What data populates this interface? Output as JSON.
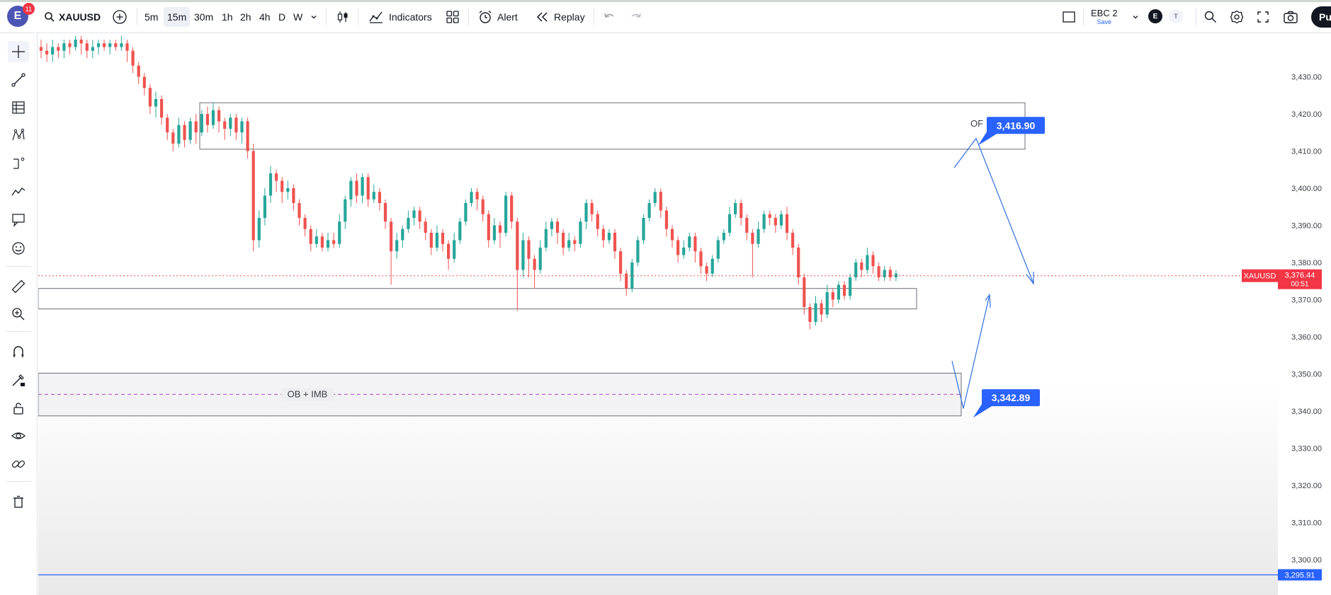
{
  "header": {
    "logo_letter": "E",
    "notification_count": "11",
    "symbol": "XAUUSD",
    "intervals": [
      "5m",
      "15m",
      "30m",
      "1h",
      "2h",
      "4h",
      "D",
      "W"
    ],
    "active_interval": "15m",
    "indicators_label": "Indicators",
    "alert_label": "Alert",
    "replay_label": "Replay",
    "layout_name": "EBC 2",
    "save_label": "Save",
    "account_chip": "E",
    "account_chip_secondary": "T",
    "publish_label": "Pub"
  },
  "chart_data": {
    "type": "candlestick",
    "symbol": "XAUUSD",
    "timeframe": "15m",
    "y_ticks": [
      "3,430.00",
      "3,420.00",
      "3,410.00",
      "3,400.00",
      "3,390.00",
      "3,380.00",
      "3,370.00",
      "3,360.00",
      "3,350.00",
      "3,340.00",
      "3,330.00",
      "3,320.00",
      "3,310.00",
      "3,300.00"
    ],
    "ylim": [
      3292,
      3440
    ],
    "current_price": "3,376.44",
    "current_price_value": 3376.44,
    "countdown": "00:51",
    "price_tag_label": "XAUUSD",
    "bottom_level": "3,295.91",
    "bottom_level_value": 3295.91,
    "zones": [
      {
        "name": "upper-zone",
        "top": 3423,
        "bottom": 3410.5,
        "label": "OF",
        "target": "3,416.90",
        "target_value": 3416.9
      },
      {
        "name": "middle-zone",
        "top": 3373,
        "bottom": 3367.5
      },
      {
        "name": "ob-imb-zone",
        "top": 3350.2,
        "bottom": 3338.7,
        "label": "OB + IMB",
        "target": "3,342.89",
        "target_value": 3342.89,
        "midline": 3344.5
      }
    ],
    "candles": [
      [
        3438,
        3437,
        3440,
        3435
      ],
      [
        3437,
        3436,
        3439,
        3434
      ],
      [
        3436,
        3438,
        3440,
        3434
      ],
      [
        3438,
        3437,
        3439,
        3435
      ],
      [
        3437,
        3439,
        3440,
        3435
      ],
      [
        3439,
        3438,
        3440,
        3436
      ],
      [
        3438,
        3440,
        3441,
        3437
      ],
      [
        3440,
        3439,
        3441,
        3436
      ],
      [
        3439,
        3437,
        3440,
        3435
      ],
      [
        3437,
        3438,
        3440,
        3435
      ],
      [
        3438,
        3439,
        3440,
        3436
      ],
      [
        3439,
        3438,
        3440,
        3437
      ],
      [
        3438,
        3439,
        3440,
        3436
      ],
      [
        3439,
        3438,
        3440,
        3437
      ],
      [
        3438,
        3439,
        3441,
        3437
      ],
      [
        3439,
        3437,
        3440,
        3434
      ],
      [
        3437,
        3433,
        3438,
        3431
      ],
      [
        3433,
        3430,
        3434,
        3428
      ],
      [
        3430,
        3427,
        3431,
        3425
      ],
      [
        3427,
        3422,
        3428,
        3420
      ],
      [
        3422,
        3424,
        3426,
        3419
      ],
      [
        3424,
        3419,
        3425,
        3417
      ],
      [
        3419,
        3415,
        3420,
        3413
      ],
      [
        3415,
        3412,
        3416,
        3410
      ],
      [
        3412,
        3417,
        3419,
        3411
      ],
      [
        3417,
        3413,
        3418,
        3411
      ],
      [
        3413,
        3418,
        3419,
        3412
      ],
      [
        3418,
        3415,
        3420,
        3412
      ],
      [
        3415,
        3420,
        3421,
        3414
      ],
      [
        3420,
        3417,
        3422,
        3415
      ],
      [
        3417,
        3421,
        3423,
        3416
      ],
      [
        3421,
        3418,
        3422,
        3415
      ],
      [
        3418,
        3416,
        3419,
        3413
      ],
      [
        3416,
        3419,
        3420,
        3414
      ],
      [
        3419,
        3415,
        3420,
        3413
      ],
      [
        3415,
        3418,
        3419,
        3412
      ],
      [
        3418,
        3410,
        3419,
        3408
      ],
      [
        3410,
        3386,
        3412,
        3383
      ],
      [
        3386,
        3392,
        3394,
        3384
      ],
      [
        3392,
        3398,
        3400,
        3390
      ],
      [
        3398,
        3404,
        3406,
        3396
      ],
      [
        3404,
        3402,
        3405,
        3399
      ],
      [
        3402,
        3399,
        3403,
        3396
      ],
      [
        3399,
        3400,
        3402,
        3397
      ],
      [
        3400,
        3396,
        3401,
        3394
      ],
      [
        3396,
        3392,
        3397,
        3390
      ],
      [
        3392,
        3389,
        3393,
        3387
      ],
      [
        3389,
        3385,
        3390,
        3383
      ],
      [
        3385,
        3387,
        3389,
        3384
      ],
      [
        3387,
        3384,
        3388,
        3383
      ],
      [
        3384,
        3386,
        3388,
        3383
      ],
      [
        3386,
        3385,
        3388,
        3384
      ],
      [
        3385,
        3391,
        3393,
        3384
      ],
      [
        3391,
        3397,
        3398,
        3389
      ],
      [
        3397,
        3402,
        3403,
        3395
      ],
      [
        3402,
        3398,
        3404,
        3396
      ],
      [
        3398,
        3403,
        3404,
        3396
      ],
      [
        3403,
        3397,
        3404,
        3395
      ],
      [
        3397,
        3399,
        3401,
        3396
      ],
      [
        3399,
        3396,
        3400,
        3394
      ],
      [
        3396,
        3391,
        3397,
        3389
      ],
      [
        3391,
        3383,
        3392,
        3374
      ],
      [
        3383,
        3386,
        3388,
        3381
      ],
      [
        3386,
        3389,
        3390,
        3384
      ],
      [
        3389,
        3392,
        3394,
        3388
      ],
      [
        3392,
        3394,
        3395,
        3390
      ],
      [
        3394,
        3391,
        3395,
        3389
      ],
      [
        3391,
        3388,
        3392,
        3386
      ],
      [
        3388,
        3384,
        3389,
        3382
      ],
      [
        3384,
        3388,
        3390,
        3383
      ],
      [
        3388,
        3385,
        3389,
        3383
      ],
      [
        3385,
        3381,
        3386,
        3378
      ],
      [
        3381,
        3386,
        3388,
        3380
      ],
      [
        3386,
        3391,
        3392,
        3385
      ],
      [
        3391,
        3396,
        3397,
        3390
      ],
      [
        3396,
        3399,
        3400,
        3395
      ],
      [
        3399,
        3397,
        3400,
        3394
      ],
      [
        3397,
        3393,
        3398,
        3391
      ],
      [
        3393,
        3386,
        3394,
        3384
      ],
      [
        3386,
        3390,
        3392,
        3385
      ],
      [
        3390,
        3388,
        3391,
        3384
      ],
      [
        3388,
        3398,
        3399,
        3387
      ],
      [
        3398,
        3391,
        3399,
        3389
      ],
      [
        3391,
        3378,
        3392,
        3367
      ],
      [
        3378,
        3386,
        3388,
        3376
      ],
      [
        3386,
        3381,
        3387,
        3376
      ],
      [
        3381,
        3378,
        3382,
        3373
      ],
      [
        3378,
        3384,
        3386,
        3377
      ],
      [
        3384,
        3389,
        3391,
        3383
      ],
      [
        3389,
        3391,
        3392,
        3387
      ],
      [
        3391,
        3388,
        3392,
        3385
      ],
      [
        3388,
        3384,
        3389,
        3382
      ],
      [
        3384,
        3386,
        3388,
        3383
      ],
      [
        3386,
        3385,
        3387,
        3383
      ],
      [
        3385,
        3391,
        3392,
        3384
      ],
      [
        3391,
        3396,
        3397,
        3389
      ],
      [
        3396,
        3393,
        3397,
        3391
      ],
      [
        3393,
        3389,
        3394,
        3387
      ],
      [
        3389,
        3386,
        3390,
        3384
      ],
      [
        3386,
        3388,
        3389,
        3385
      ],
      [
        3388,
        3383,
        3389,
        3381
      ],
      [
        3383,
        3377,
        3384,
        3375
      ],
      [
        3377,
        3373,
        3378,
        3371
      ],
      [
        3373,
        3380,
        3381,
        3372
      ],
      [
        3380,
        3386,
        3387,
        3379
      ],
      [
        3386,
        3392,
        3393,
        3385
      ],
      [
        3392,
        3396,
        3397,
        3391
      ],
      [
        3396,
        3399,
        3400,
        3395
      ],
      [
        3399,
        3394,
        3400,
        3392
      ],
      [
        3394,
        3389,
        3395,
        3387
      ],
      [
        3389,
        3386,
        3390,
        3384
      ],
      [
        3386,
        3382,
        3387,
        3380
      ],
      [
        3382,
        3384,
        3386,
        3381
      ],
      [
        3384,
        3387,
        3388,
        3383
      ],
      [
        3387,
        3383,
        3388,
        3380
      ],
      [
        3383,
        3379,
        3384,
        3377
      ],
      [
        3379,
        3377,
        3380,
        3375
      ],
      [
        3377,
        3381,
        3382,
        3376
      ],
      [
        3381,
        3386,
        3387,
        3380
      ],
      [
        3386,
        3388,
        3389,
        3385
      ],
      [
        3388,
        3393,
        3395,
        3387
      ],
      [
        3393,
        3396,
        3397,
        3392
      ],
      [
        3396,
        3392,
        3397,
        3390
      ],
      [
        3392,
        3388,
        3393,
        3386
      ],
      [
        3388,
        3385,
        3389,
        3376
      ],
      [
        3385,
        3389,
        3391,
        3384
      ],
      [
        3389,
        3393,
        3394,
        3388
      ],
      [
        3393,
        3392,
        3394,
        3390
      ],
      [
        3392,
        3390,
        3393,
        3388
      ],
      [
        3390,
        3393,
        3394,
        3389
      ],
      [
        3393,
        3388,
        3395,
        3386
      ],
      [
        3388,
        3384,
        3389,
        3382
      ],
      [
        3384,
        3376,
        3385,
        3374
      ],
      [
        3376,
        3368,
        3377,
        3366
      ],
      [
        3368,
        3364,
        3369,
        3362
      ],
      [
        3364,
        3369,
        3371,
        3363
      ],
      [
        3369,
        3366,
        3370,
        3364
      ],
      [
        3366,
        3372,
        3374,
        3365
      ],
      [
        3372,
        3370,
        3373,
        3368
      ],
      [
        3370,
        3374,
        3375,
        3369
      ],
      [
        3374,
        3371,
        3375,
        3370
      ],
      [
        3371,
        3376,
        3377,
        3370
      ],
      [
        3376,
        3380,
        3381,
        3375
      ],
      [
        3380,
        3378,
        3381,
        3376
      ],
      [
        3378,
        3382,
        3384,
        3377
      ],
      [
        3382,
        3379,
        3383,
        3377
      ],
      [
        3379,
        3376,
        3380,
        3375
      ],
      [
        3376,
        3378,
        3379,
        3375
      ],
      [
        3378,
        3376,
        3379,
        3375
      ],
      [
        3376,
        3377,
        3378,
        3375
      ]
    ]
  }
}
